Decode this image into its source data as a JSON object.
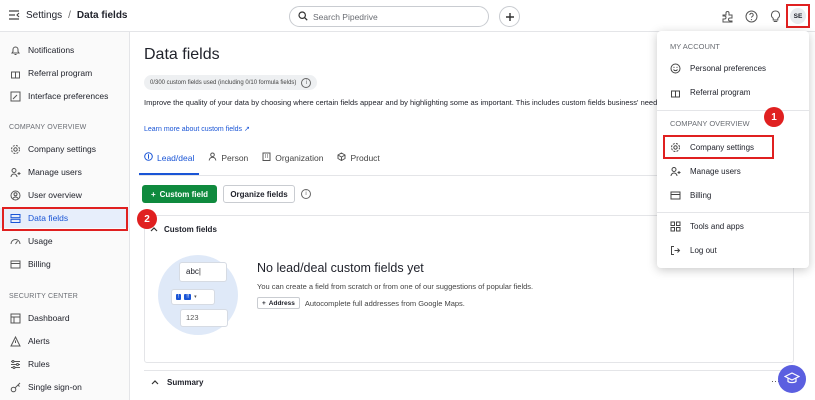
{
  "topbar": {
    "breadcrumb_parent": "Settings",
    "breadcrumb_separator": "/",
    "breadcrumb_current": "Data fields",
    "search_placeholder": "Search Pipedrive",
    "avatar_initials": "SE"
  },
  "sidebar": {
    "items_top": [
      {
        "label": "Notifications",
        "icon": "bell-icon"
      },
      {
        "label": "Referral program",
        "icon": "gift-icon"
      },
      {
        "label": "Interface preferences",
        "icon": "interface-icon"
      }
    ],
    "company_section": "COMPANY OVERVIEW",
    "company_items": [
      {
        "label": "Company settings",
        "icon": "gear-icon"
      },
      {
        "label": "Manage users",
        "icon": "users-icon"
      },
      {
        "label": "User overview",
        "icon": "user-circle-icon"
      },
      {
        "label": "Data fields",
        "icon": "fields-icon"
      },
      {
        "label": "Usage",
        "icon": "gauge-icon"
      },
      {
        "label": "Billing",
        "icon": "card-icon"
      }
    ],
    "security_section": "SECURITY CENTER",
    "security_items": [
      {
        "label": "Dashboard",
        "icon": "dashboard-icon"
      },
      {
        "label": "Alerts",
        "icon": "alert-icon"
      },
      {
        "label": "Rules",
        "icon": "rules-icon"
      },
      {
        "label": "Single sign-on",
        "icon": "key-icon"
      }
    ]
  },
  "main": {
    "title": "Data fields",
    "usage_text": "0/300 custom fields used (including 0/10 formula fields)",
    "description": "Improve the quality of your data by choosing where certain fields appear and by highlighting some as important. This includes custom fields business' needs.",
    "learn_more": "Learn more about custom fields",
    "tabs": [
      {
        "label": "Lead/deal",
        "icon": "deal-icon"
      },
      {
        "label": "Person",
        "icon": "person-icon"
      },
      {
        "label": "Organization",
        "icon": "building-icon"
      },
      {
        "label": "Product",
        "icon": "box-icon"
      }
    ],
    "add_button": "Custom field",
    "organize_button": "Organize fields",
    "panel_title": "Custom fields",
    "illustration_text": "abc",
    "illustration_number": "123",
    "empty_title": "No lead/deal custom fields yet",
    "empty_sub": "You can create a field from scratch or from one of our suggestions of popular fields.",
    "address_chip": "Address",
    "address_desc": "Autocomplete full addresses from Google Maps.",
    "summary_title": "Summary"
  },
  "dropdown": {
    "my_account_section": "MY ACCOUNT",
    "my_account_items": [
      {
        "label": "Personal preferences",
        "icon": "smiley-icon"
      },
      {
        "label": "Referral program",
        "icon": "gift-icon"
      }
    ],
    "company_section": "COMPANY OVERVIEW",
    "company_items": [
      {
        "label": "Company settings",
        "icon": "gear-icon"
      },
      {
        "label": "Manage users",
        "icon": "users-icon"
      },
      {
        "label": "Billing",
        "icon": "card-icon"
      }
    ],
    "other_items": [
      {
        "label": "Tools and apps",
        "icon": "apps-icon"
      },
      {
        "label": "Log out",
        "icon": "logout-icon"
      }
    ]
  },
  "annotations": {
    "badge_1": "1",
    "badge_2": "2"
  },
  "colors": {
    "accent": "#1a55d6",
    "primary_button": "#0f8a3e",
    "highlight": "#e02020"
  }
}
